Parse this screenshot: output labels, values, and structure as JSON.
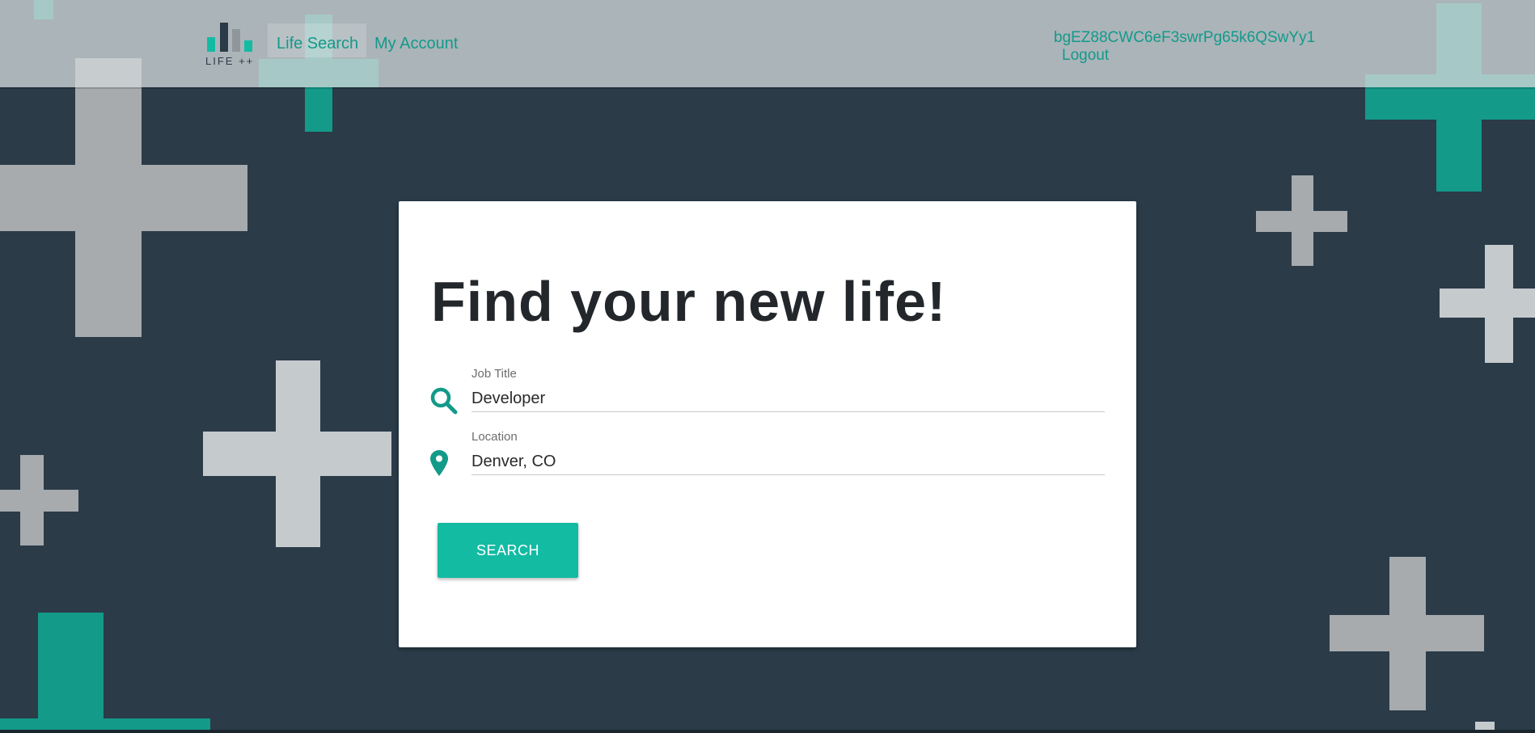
{
  "header": {
    "logo_text": "LIFE ++",
    "nav": [
      {
        "label": "Life Search"
      },
      {
        "label": "My Account"
      }
    ],
    "user": {
      "name": "bgEZ88CWC6eF3swrPg65k6QSwYy1",
      "logout_label": "Logout"
    }
  },
  "main": {
    "title": "Find your new life!",
    "fields": {
      "job_title": {
        "label": "Job Title",
        "value": "Developer",
        "icon": "search-icon"
      },
      "location": {
        "label": "Location",
        "value": "Denver, CO",
        "icon": "location-pin-icon"
      }
    },
    "search_button_label": "SEARCH"
  },
  "colors": {
    "background": "#2b3b48",
    "accent": "#13bba3",
    "link": "#129a8a",
    "card": "#ffffff",
    "plus_gray": "#a7abae",
    "plus_light": "#c5cacd",
    "plus_teal": "#139a89"
  }
}
